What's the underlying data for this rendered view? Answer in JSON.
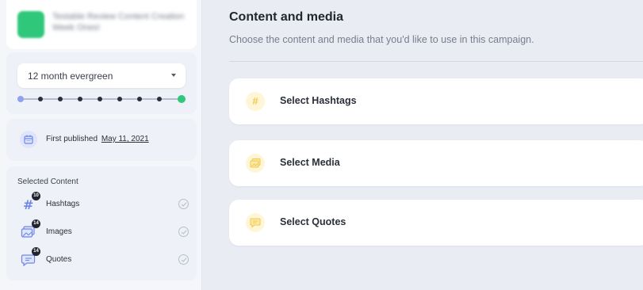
{
  "campaign": {
    "name": "Testable Review Content Creation Week Ones!",
    "avatar_color": "#2fc77a"
  },
  "schedule": {
    "selected_value": "12 month evergreen",
    "timeline_points": 9
  },
  "published": {
    "label": "First published",
    "date": "May 11, 2021"
  },
  "selected_content": {
    "title": "Selected Content",
    "items": [
      {
        "label": "Hashtags",
        "count": "10",
        "icon": "hashtag-icon",
        "checked": false
      },
      {
        "label": "Images",
        "count": "14",
        "icon": "images-icon",
        "checked": false
      },
      {
        "label": "Quotes",
        "count": "14",
        "icon": "quote-icon",
        "checked": false
      }
    ]
  },
  "main": {
    "title": "Content and media",
    "subtitle": "Choose the content and media that you'd like to use in this campaign.",
    "options": [
      {
        "label": "Select Hashtags",
        "icon": "hashtag-icon"
      },
      {
        "label": "Select Media",
        "icon": "media-icon"
      },
      {
        "label": "Select Quotes",
        "icon": "quote-icon"
      }
    ]
  },
  "colors": {
    "accent_green": "#2fc77a",
    "accent_blue": "#8da3f0",
    "icon_yellow": "#f2c94c",
    "background": "#e9ecf3"
  }
}
